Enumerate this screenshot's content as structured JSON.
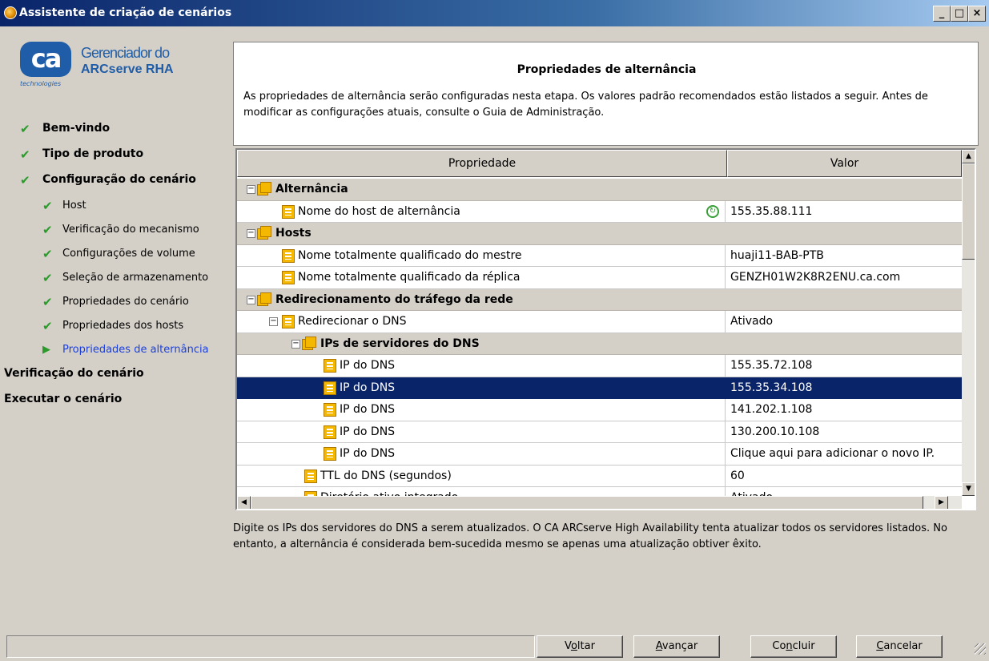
{
  "window": {
    "title": "Assistente de criação de cenários",
    "buttons": {
      "minimize": "_",
      "maximize": "□",
      "close": "×"
    }
  },
  "logo": {
    "mark": "ca",
    "tagline": "technologies",
    "line1": "Gerenciador do",
    "line2": "ARCserve RHA"
  },
  "steps": [
    {
      "label": "Bem-vindo",
      "level": "main",
      "done": true
    },
    {
      "label": "Tipo de produto",
      "level": "main",
      "done": true
    },
    {
      "label": "Configuração do cenário",
      "level": "main",
      "done": true
    },
    {
      "label": "Host",
      "level": "sub",
      "done": true
    },
    {
      "label": "Verificação do mecanismo",
      "level": "sub",
      "done": true
    },
    {
      "label": "Configurações de volume",
      "level": "sub",
      "done": true
    },
    {
      "label": "Seleção de armazenamento",
      "level": "sub",
      "done": true
    },
    {
      "label": "Propriedades do cenário",
      "level": "sub",
      "done": true
    },
    {
      "label": "Propriedades dos hosts",
      "level": "sub",
      "done": true
    },
    {
      "label": "Propriedades de alternância",
      "level": "sub",
      "current": true
    },
    {
      "label": "Verificação do cenário",
      "level": "main"
    },
    {
      "label": "Executar o cenário",
      "level": "main"
    }
  ],
  "header": {
    "title": "Propriedades de alternância",
    "description": "As propriedades de alternância serão configuradas nesta etapa. Os valores padrão recomendados estão listados a seguir. Antes de modificar as configurações atuais, consulte o Guia de Administração."
  },
  "grid": {
    "columns": {
      "property": "Propriedade",
      "value": "Valor"
    },
    "rows": [
      {
        "type": "group",
        "label": "Alternância",
        "indent": 0
      },
      {
        "type": "item",
        "label": "Nome do host de alternância",
        "value": "155.35.88.111",
        "indent": 1,
        "refresh": true
      },
      {
        "type": "group",
        "label": "Hosts",
        "indent": 0
      },
      {
        "type": "item",
        "label": "Nome totalmente qualificado do mestre",
        "value": "huaji11-BAB-PTB",
        "indent": 1
      },
      {
        "type": "item",
        "label": "Nome totalmente qualificado da réplica",
        "value": "GENZH01W2K8R2ENU.ca.com",
        "indent": 1
      },
      {
        "type": "group",
        "label": "Redirecionamento do tráfego da rede",
        "indent": 0
      },
      {
        "type": "item",
        "label": "Redirecionar o DNS",
        "value": "Ativado",
        "indent": 1,
        "expand": true
      },
      {
        "type": "group",
        "label": "IPs de servidores do DNS",
        "indent": 2
      },
      {
        "type": "item",
        "label": "IP do DNS",
        "value": "155.35.72.108",
        "indent": 3
      },
      {
        "type": "item",
        "label": "IP do DNS",
        "value": "155.35.34.108",
        "indent": 3,
        "selected": true
      },
      {
        "type": "item",
        "label": "IP do DNS",
        "value": "141.202.1.108",
        "indent": 3
      },
      {
        "type": "item",
        "label": "IP do DNS",
        "value": "130.200.10.108",
        "indent": 3
      },
      {
        "type": "item",
        "label": "IP do DNS",
        "value": "Clique aqui para adicionar o novo IP.",
        "indent": 3
      },
      {
        "type": "item",
        "label": "TTL do DNS (segundos)",
        "value": "60",
        "indent": 2
      },
      {
        "type": "item",
        "label": "Diretório ativo integrado",
        "value": "Ativado",
        "indent": 2
      }
    ]
  },
  "help_text": "Digite os IPs dos servidores do DNS a serem atualizados. O CA ARCserve High Availability tenta atualizar todos os servidores listados. No entanto, a alternância é considerada bem-sucedida mesmo se apenas uma atualização obtiver êxito.",
  "buttons": {
    "back": {
      "pre": "V",
      "u": "o",
      "post": "ltar"
    },
    "next": {
      "pre": "",
      "u": "A",
      "post": "vançar"
    },
    "finish": {
      "pre": "Co",
      "u": "n",
      "post": "cluir"
    },
    "cancel": {
      "pre": "",
      "u": "C",
      "post": "ancelar"
    }
  },
  "colors": {
    "titlebar": "#0a246a",
    "selection": "#0a246a",
    "current_step": "#1a3fe0",
    "check": "#2a9a2a",
    "brand": "#1f5da8"
  }
}
